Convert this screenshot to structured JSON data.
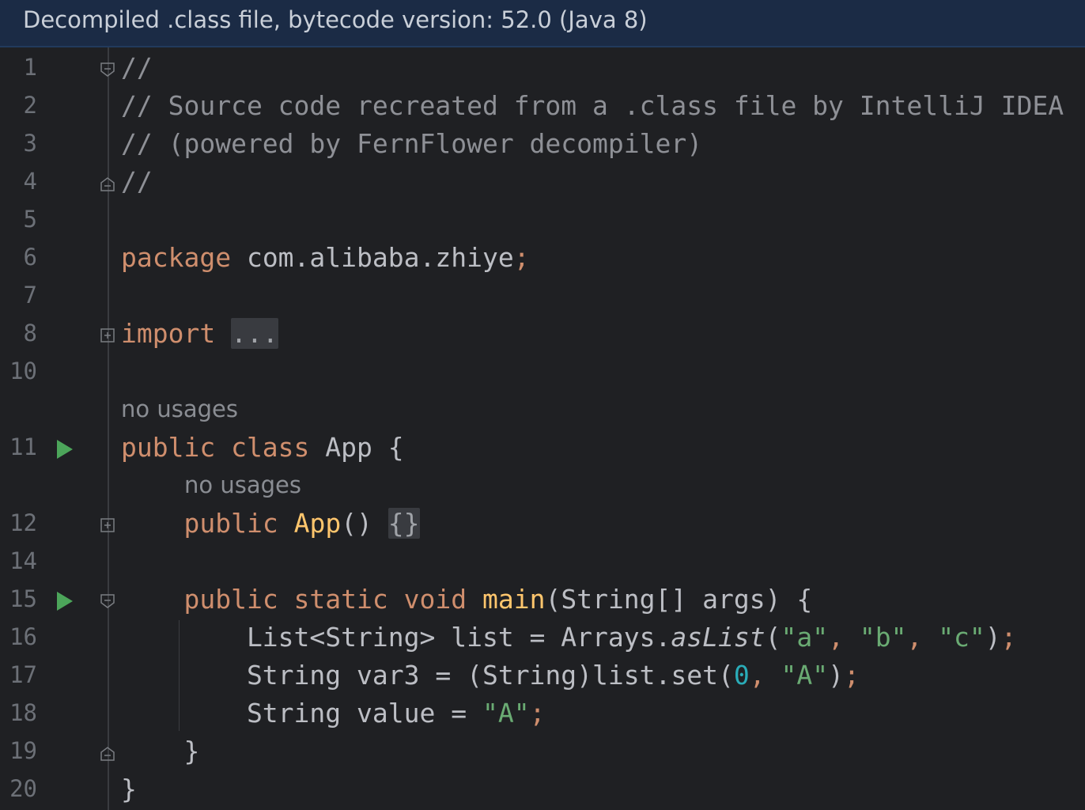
{
  "banner": {
    "text": "Decompiled .class file, bytecode version: 52.0 (Java 8)"
  },
  "lines": [
    {
      "num": "1",
      "parts": [
        {
          "t": "//",
          "c": "cmt"
        }
      ],
      "fold": "open-top"
    },
    {
      "num": "2",
      "parts": [
        {
          "t": "// Source code recreated from a .class file by IntelliJ IDEA",
          "c": "cmt"
        }
      ]
    },
    {
      "num": "3",
      "parts": [
        {
          "t": "// (powered by FernFlower decompiler)",
          "c": "cmt"
        }
      ]
    },
    {
      "num": "4",
      "parts": [
        {
          "t": "//",
          "c": "cmt"
        }
      ],
      "fold": "close-bottom"
    },
    {
      "num": "5",
      "parts": []
    },
    {
      "num": "6",
      "parts": [
        {
          "t": "package",
          "c": "kw"
        },
        {
          "t": " com.alibaba.zhiye",
          "c": ""
        },
        {
          "t": ";",
          "c": "kw"
        }
      ]
    },
    {
      "num": "7",
      "parts": []
    },
    {
      "num": "8",
      "parts": [
        {
          "t": "import",
          "c": "kw"
        },
        {
          "t": " ",
          "c": ""
        },
        {
          "t": "...",
          "c": "fold-box"
        }
      ],
      "fold": "collapsed"
    },
    {
      "num": "10",
      "parts": []
    },
    {
      "hint": "no usages",
      "hint_indent": 0
    },
    {
      "num": "11",
      "parts": [
        {
          "t": "public class",
          "c": "kw"
        },
        {
          "t": " App {",
          "c": ""
        }
      ],
      "run": true
    },
    {
      "hint": "no usages",
      "hint_indent": 1
    },
    {
      "num": "12",
      "parts": [
        {
          "t": "    ",
          "c": ""
        },
        {
          "t": "public",
          "c": "kw"
        },
        {
          "t": " ",
          "c": ""
        },
        {
          "t": "App",
          "c": "fn"
        },
        {
          "t": "() ",
          "c": ""
        },
        {
          "t": "{}",
          "c": "fold-box"
        }
      ],
      "fold": "collapsed"
    },
    {
      "num": "14",
      "parts": []
    },
    {
      "num": "15",
      "parts": [
        {
          "t": "    ",
          "c": ""
        },
        {
          "t": "public static void",
          "c": "kw"
        },
        {
          "t": " ",
          "c": ""
        },
        {
          "t": "main",
          "c": "fn"
        },
        {
          "t": "(String[] args) {",
          "c": ""
        }
      ],
      "run": true,
      "fold": "open-top"
    },
    {
      "num": "16",
      "parts": [
        {
          "t": "        List<String> list = Arrays.",
          "c": ""
        },
        {
          "t": "asList",
          "c": "ital"
        },
        {
          "t": "(",
          "c": ""
        },
        {
          "t": "\"a\"",
          "c": "str"
        },
        {
          "t": ", ",
          "c": "kw"
        },
        {
          "t": "\"b\"",
          "c": "str"
        },
        {
          "t": ", ",
          "c": "kw"
        },
        {
          "t": "\"c\"",
          "c": "str"
        },
        {
          "t": ")",
          "c": ""
        },
        {
          "t": ";",
          "c": "kw"
        }
      ]
    },
    {
      "num": "17",
      "parts": [
        {
          "t": "        String var3 = (String)list.set(",
          "c": ""
        },
        {
          "t": "0",
          "c": "num"
        },
        {
          "t": ", ",
          "c": "kw"
        },
        {
          "t": "\"A\"",
          "c": "str"
        },
        {
          "t": ")",
          "c": ""
        },
        {
          "t": ";",
          "c": "kw"
        }
      ]
    },
    {
      "num": "18",
      "parts": [
        {
          "t": "        String value = ",
          "c": ""
        },
        {
          "t": "\"A\"",
          "c": "str"
        },
        {
          "t": ";",
          "c": "kw"
        }
      ]
    },
    {
      "num": "19",
      "parts": [
        {
          "t": "    }",
          "c": ""
        }
      ],
      "fold": "close-bottom"
    },
    {
      "num": "20",
      "parts": [
        {
          "t": "}",
          "c": ""
        }
      ]
    }
  ]
}
